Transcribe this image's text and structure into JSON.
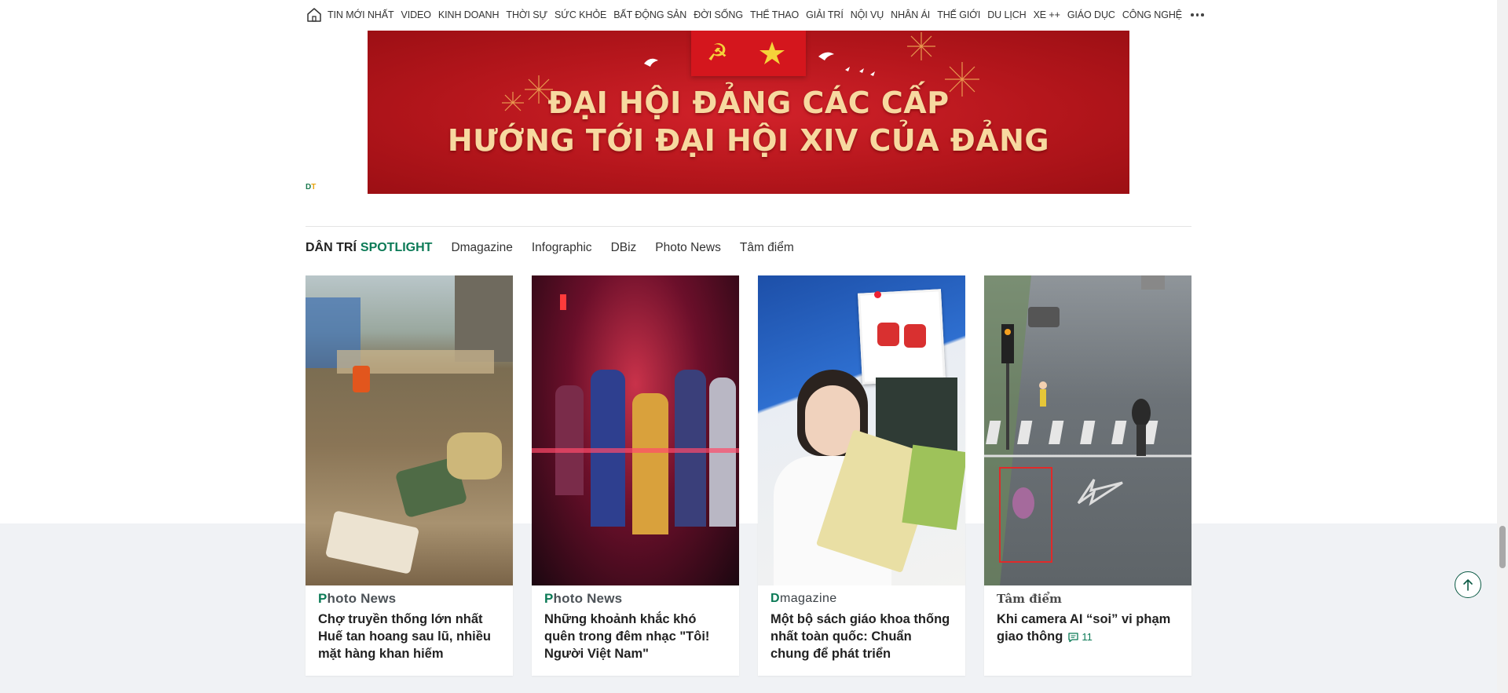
{
  "nav": {
    "items": [
      "TIN MỚI NHẤT",
      "VIDEO",
      "KINH DOANH",
      "THỜI SỰ",
      "SỨC KHỎE",
      "BẤT ĐỘNG SẢN",
      "ĐỜI SỐNG",
      "THỂ THAO",
      "GIẢI TRÍ",
      "NỘI VỤ",
      "NHÂN ÁI",
      "THẾ GIỚI",
      "DU LỊCH",
      "XE ++",
      "GIÁO DỤC",
      "CÔNG NGHỆ"
    ],
    "home_icon": "home-icon",
    "more_icon": "more-dots-icon"
  },
  "banner": {
    "line1": "ĐẠI HỘI ĐẢNG CÁC CẤP",
    "line2": "HƯỚNG TỚI ĐẠI HỘI XIV CỦA ĐẢNG"
  },
  "ad_mark": {
    "d": "D",
    "t": "T"
  },
  "spotlight": {
    "brand_a": "DÂN TRÍ",
    "brand_b": "SPOTLIGHT",
    "tabs": [
      "Dmagazine",
      "Infographic",
      "DBiz",
      "Photo News",
      "Tâm điểm"
    ]
  },
  "cards": [
    {
      "badge_p": "P",
      "badge_rest": "hoto News",
      "title": "Chợ truyền thống lớn nhất Huế tan hoang sau lũ, nhiều mặt hàng khan hiếm"
    },
    {
      "badge_p": "P",
      "badge_rest": "hoto News",
      "title": "Những khoảnh khắc khó quên trong đêm nhạc \"Tôi! Người Việt Nam\""
    },
    {
      "badge_d": "D",
      "badge_rest": "magazine",
      "title": "Một bộ sách giáo khoa thống nhất toàn quốc: Chuẩn chung để phát triển"
    },
    {
      "badge": "Tâm điểm",
      "title": "Khi camera AI “soi” vi phạm giao thông",
      "comments": "11"
    }
  ],
  "colors": {
    "brand_green": "#0b7a56",
    "banner_red": "#b5161c",
    "banner_text": "#f7d9a0"
  }
}
